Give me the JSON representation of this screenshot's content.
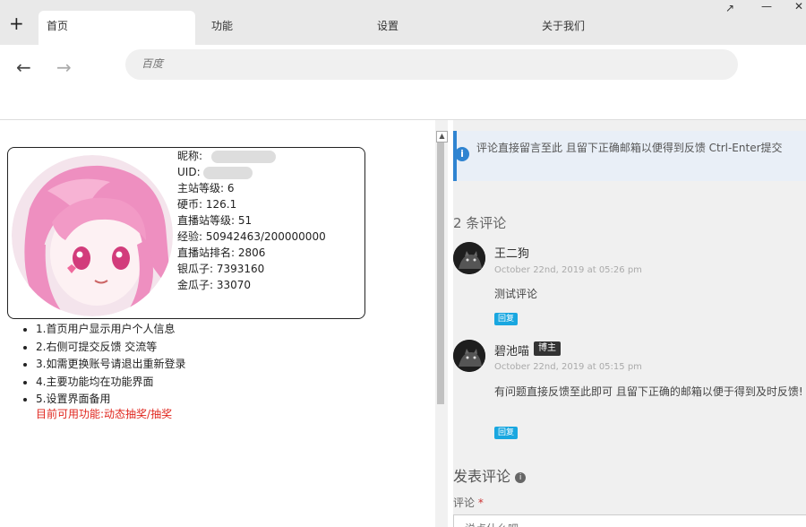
{
  "window": {
    "new_tab": "+",
    "tabs": [
      {
        "label": "首页"
      },
      {
        "label": "功能"
      },
      {
        "label": "设置"
      },
      {
        "label": "关于我们"
      }
    ],
    "controls": {
      "restore": "↗",
      "minimize": "—",
      "close": "✕"
    }
  },
  "nav": {
    "back": "←",
    "forward": "→",
    "address_placeholder": "百度"
  },
  "profile": {
    "nickname_label": "昵称:",
    "uid_label": "UID:",
    "main_level_label": "主站等级:",
    "main_level": "6",
    "coins_label": "硬币:",
    "coins": "126.1",
    "live_level_label": "直播站等级:",
    "live_level": "51",
    "exp_label": "经验:",
    "exp": "50942463/200000000",
    "live_rank_label": "直播站排名:",
    "live_rank": "2806",
    "silver_label": "银瓜子:",
    "silver": "7393160",
    "gold_label": "金瓜子:",
    "gold": "33070"
  },
  "notes": [
    "1.首页用户显示用户个人信息",
    "2.右侧可提交反馈 交流等",
    "3.如需更换账号请退出重新登录",
    "4.主要功能均在功能界面",
    "5.设置界面备用"
  ],
  "available_features": "目前可用功能:动态抽奖/抽奖",
  "comments_panel": {
    "info": "评论直接留言至此 且留下正确邮箱以便得到反馈 Ctrl-Enter提交",
    "count_title": "2 条评论",
    "comments": [
      {
        "author": "王二狗",
        "date": "October 22nd, 2019 at 05:26 pm",
        "text": "测试评论",
        "reply": "回复"
      },
      {
        "author": "碧池喵",
        "badge": "博主",
        "date": "October 22nd, 2019 at 05:15 pm",
        "text": "有问题直接反馈至此即可 且留下正确的邮箱以便于得到及时反馈!",
        "reply": "回复"
      }
    ],
    "post_title": "发表评论",
    "post_info_icon": "i",
    "field_label": "评论",
    "required_mark": "*",
    "textarea_placeholder": "说点什么吧"
  }
}
